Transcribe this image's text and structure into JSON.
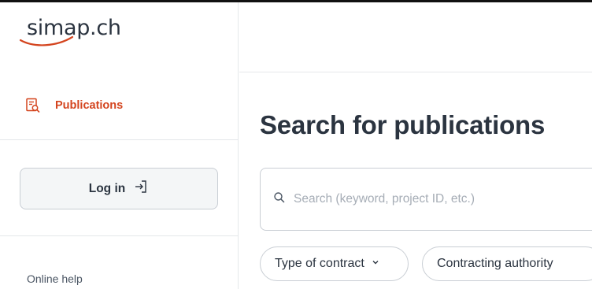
{
  "brand": {
    "logo_text": "simap.ch",
    "accent_color": "#d4451f"
  },
  "sidebar": {
    "nav": [
      {
        "label": "Publications",
        "icon": "publications-search-icon",
        "active": true
      }
    ],
    "login": {
      "label": "Log in",
      "icon": "login-icon"
    },
    "help": {
      "label": "Online help"
    }
  },
  "main": {
    "title": "Search for publications",
    "search": {
      "placeholder": "Search (keyword, project ID, etc.)",
      "value": "",
      "icon": "search-icon"
    },
    "filters": [
      {
        "label": "Type of contract",
        "icon": "chevron-down-icon"
      },
      {
        "label": "Contracting authority"
      }
    ]
  }
}
